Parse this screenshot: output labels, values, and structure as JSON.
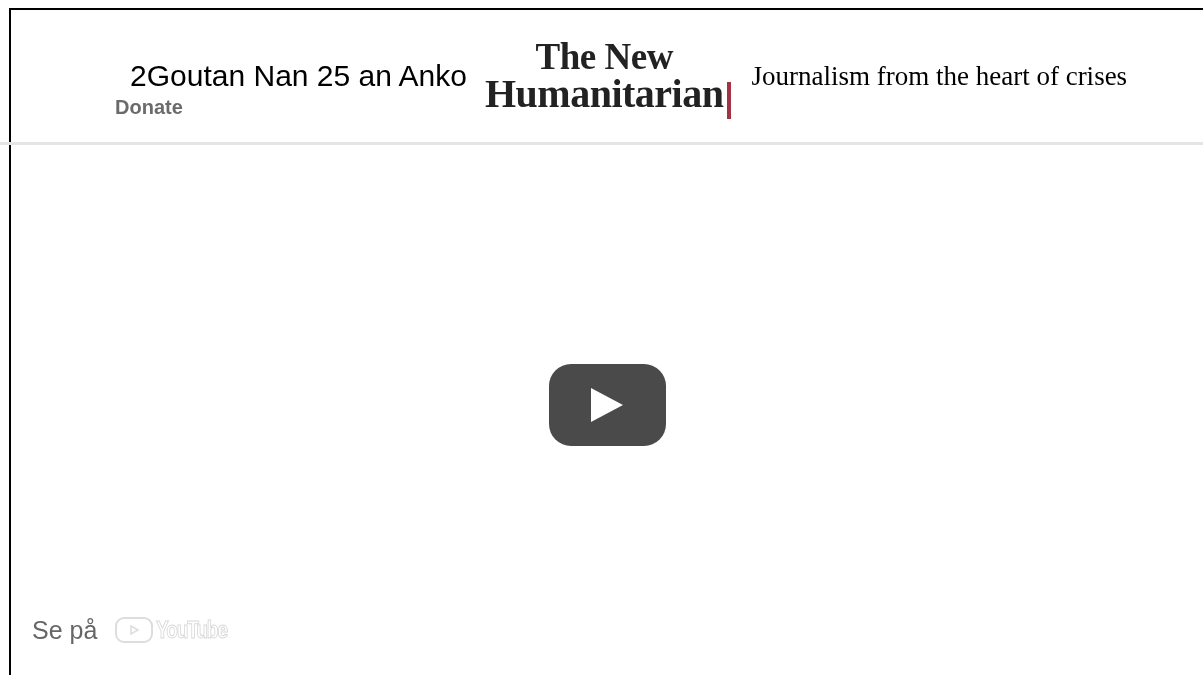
{
  "header": {
    "video_title": "2Goutan Nan 25 an Anko",
    "donate": "Donate",
    "logo": {
      "line_1": "The New",
      "line_2": "Humanitarian"
    },
    "tagline": "Journalism from the heart of crises"
  },
  "player": {
    "watch_on": "Se på",
    "youtube_label": "YouTube"
  }
}
